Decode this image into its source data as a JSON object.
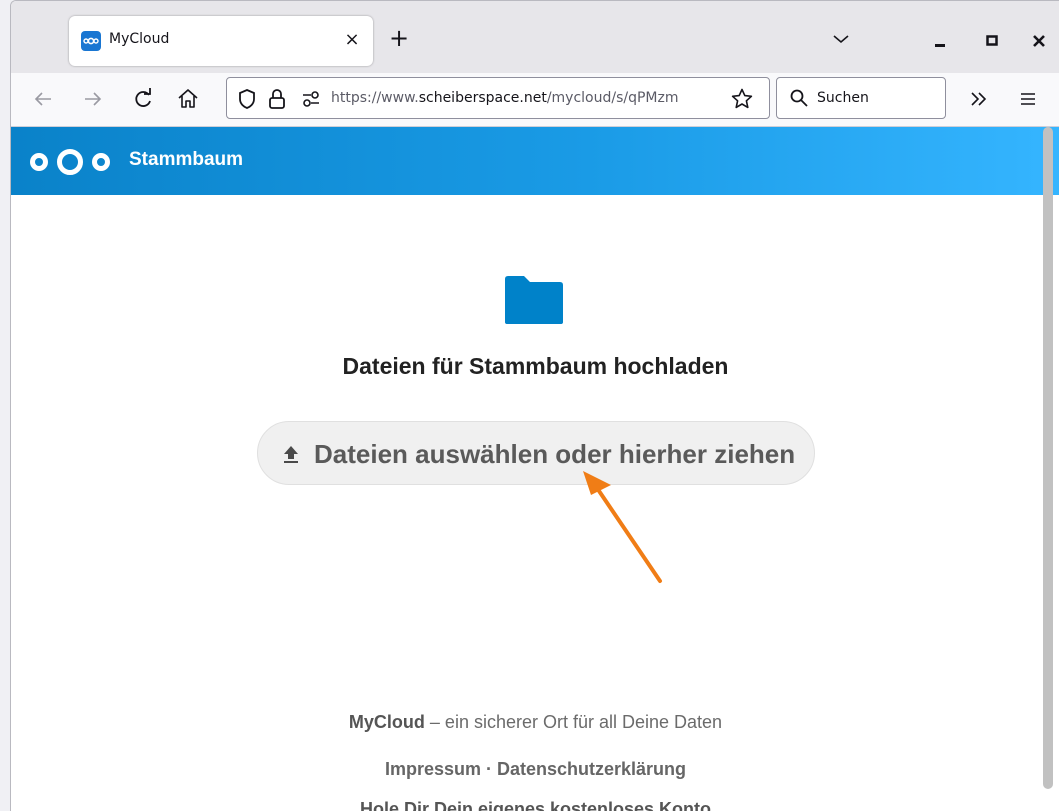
{
  "browser": {
    "tab_title": "MyCloud",
    "tab_close_glyph": "×",
    "new_tab_glyph": "+",
    "url_prefix": "https://www.",
    "url_domain": "scheiberspace.net",
    "url_path": "/mycloud/s/qPMzm",
    "search_placeholder": "Suchen"
  },
  "header": {
    "title": "Stammbaum"
  },
  "upload": {
    "heading": "Dateien für Stammbaum hochladen",
    "button_label": "Dateien auswählen oder hierher ziehen"
  },
  "footer": {
    "brand": "MyCloud",
    "tagline_rest": " – ein sicherer Ort für all Deine Daten",
    "impressum": "Impressum",
    "separator": " · ",
    "privacy": "Datenschutzerklärung",
    "cta": "Hole Dir Dein eigenes kostenloses Konto"
  },
  "colors": {
    "brand_blue": "#0082c9",
    "annotation_arrow": "#f07d16"
  },
  "icons": [
    "nextcloud-logo-icon",
    "folder-icon",
    "upload-icon",
    "search-icon",
    "star-icon",
    "shield-icon",
    "lock-icon"
  ]
}
